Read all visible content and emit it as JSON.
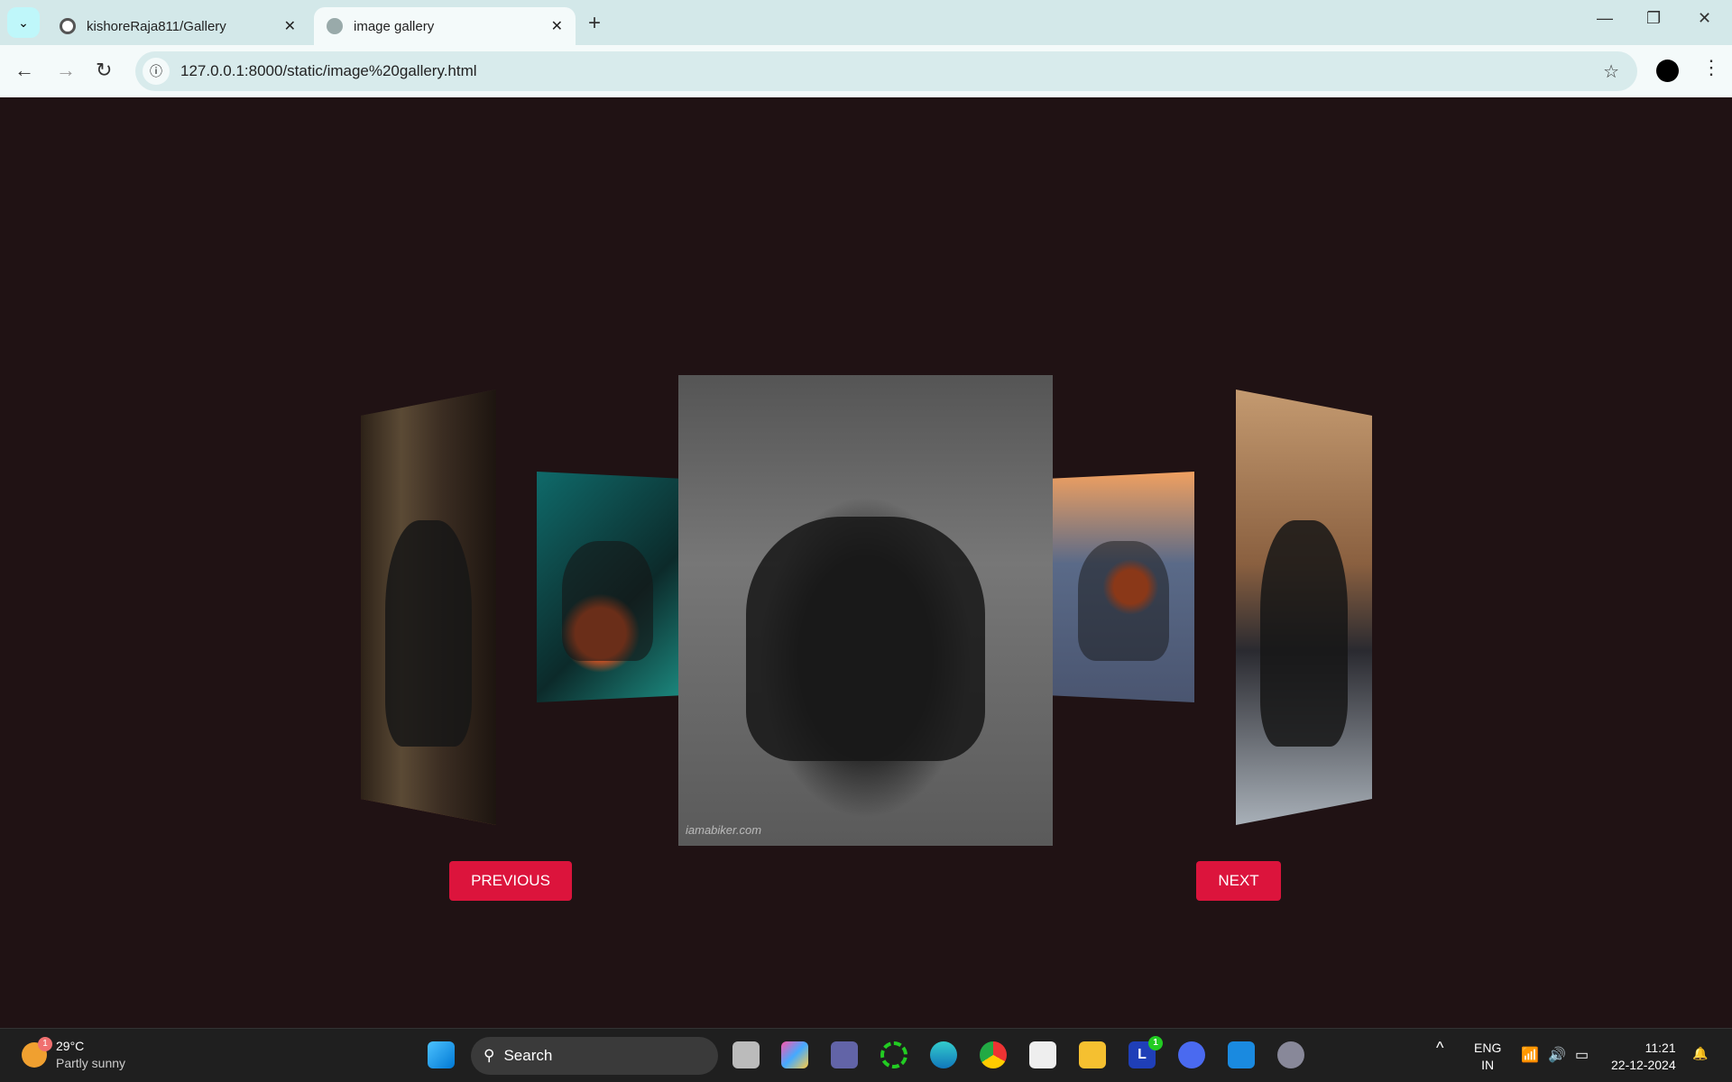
{
  "browser": {
    "tabs": [
      {
        "title": "kishoreRaja811/Gallery",
        "icon": "github-icon"
      },
      {
        "title": "image gallery",
        "icon": "globe-icon",
        "active": true
      }
    ],
    "url": "127.0.0.1:8000/static/image%20gallery.html"
  },
  "gallery": {
    "watermark": "iamabiker.com",
    "previous_label": "PREVIOUS",
    "next_label": "NEXT",
    "colors": {
      "background": "#201214",
      "button": "#dc143c"
    }
  },
  "taskbar": {
    "weather_temp": "29°C",
    "weather_desc": "Partly sunny",
    "weather_badge": "1",
    "search_label": "Search",
    "lang": "ENG",
    "region": "IN",
    "time": "11:21",
    "date": "22-12-2024",
    "l_badge": "1"
  }
}
